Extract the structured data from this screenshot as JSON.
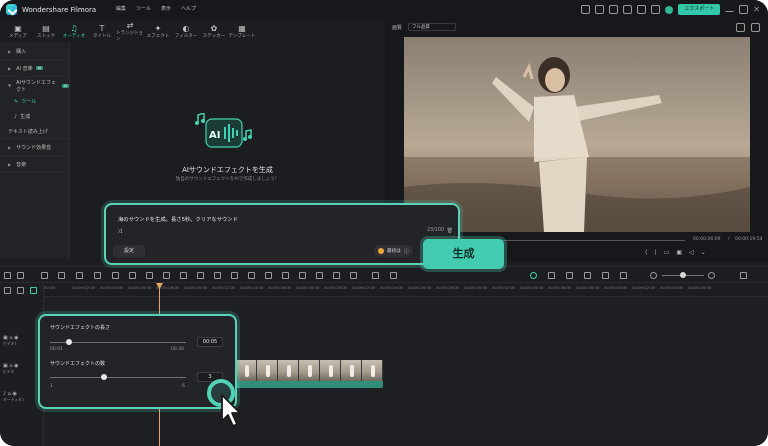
{
  "app": {
    "name": "Wondershare Filmora",
    "menus": [
      "編集",
      "ツール",
      "表示",
      "ヘルプ"
    ],
    "export_label": "エクスポート"
  },
  "media_tabs": [
    {
      "label": "メディア",
      "icon": "media-icon"
    },
    {
      "label": "ストック",
      "icon": "stock-icon"
    },
    {
      "label": "オーディオ",
      "icon": "audio-icon",
      "active": true
    },
    {
      "label": "タイトル",
      "icon": "title-icon"
    },
    {
      "label": "トランジション",
      "icon": "transition-icon"
    },
    {
      "label": "エフェクト",
      "icon": "effect-icon"
    },
    {
      "label": "フィルター",
      "icon": "filter-icon"
    },
    {
      "label": "ステッカー",
      "icon": "sticker-icon"
    },
    {
      "label": "テンプレート",
      "icon": "template-icon"
    }
  ],
  "sidebar": {
    "items": [
      {
        "label": "購入"
      },
      {
        "label": "AI 音楽"
      },
      {
        "label": "AIサウンドエフェクト"
      }
    ],
    "sub_items": [
      {
        "label": "ツール",
        "active": true
      },
      {
        "label": "生成"
      }
    ],
    "items2": [
      {
        "label": "テキスト読み上げ"
      },
      {
        "label": "サウンド効果音"
      },
      {
        "label": "音楽"
      }
    ],
    "badge": "AI"
  },
  "media": {
    "ai_title": "AIサウンドエフェクトを生成",
    "ai_desc": "独自のサウンドエフェクトをAIで作成しましょう！",
    "ai_glyph": "AI"
  },
  "preview": {
    "quality_label": "画質",
    "quality_value": "フル品質",
    "time_current": "00:00:06:09",
    "time_total": "00:00:19:54"
  },
  "prompt": {
    "text": "海のサウンドを生成。長さ5秒。クリアなサウンド",
    "counter": "23/100",
    "settings_label": "設定",
    "credits_label": "最初は",
    "generate_label": "生成"
  },
  "sfx": {
    "duration_label": "サウンドエフェクトの長さ",
    "duration_value": "00:05",
    "duration_min": "00:01",
    "duration_max": "00:30",
    "duration_fraction": 0.14,
    "count_label": "サウンドエフェクトの数",
    "count_value": "3",
    "count_min": "1",
    "count_max": "6",
    "count_fraction": 0.4
  },
  "ruler": [
    "00:00",
    "00:00:02:00",
    "00:00:04:00",
    "00:00:06:00",
    "00:00:08:00",
    "00:00:10:00",
    "00:00:12:00",
    "00:00:14:00",
    "00:00:16:00",
    "00:00:18:00",
    "00:00:20:00",
    "00:00:22:00",
    "00:00:24:00",
    "00:00:26:00",
    "00:00:28:00",
    "00:00:30:00",
    "00:00:32:00",
    "00:00:34:00",
    "00:00:36:00",
    "00:00:38:00",
    "00:00:40:00",
    "00:00:42:00",
    "00:00:44:00",
    "00:00:46:00"
  ],
  "tracks": [
    "ビデオ1",
    "ビデオ",
    "オーディオ1"
  ],
  "colors": {
    "accent": "#43cbb0",
    "playhead": "#e8a566",
    "bg": "#1c1d20"
  }
}
